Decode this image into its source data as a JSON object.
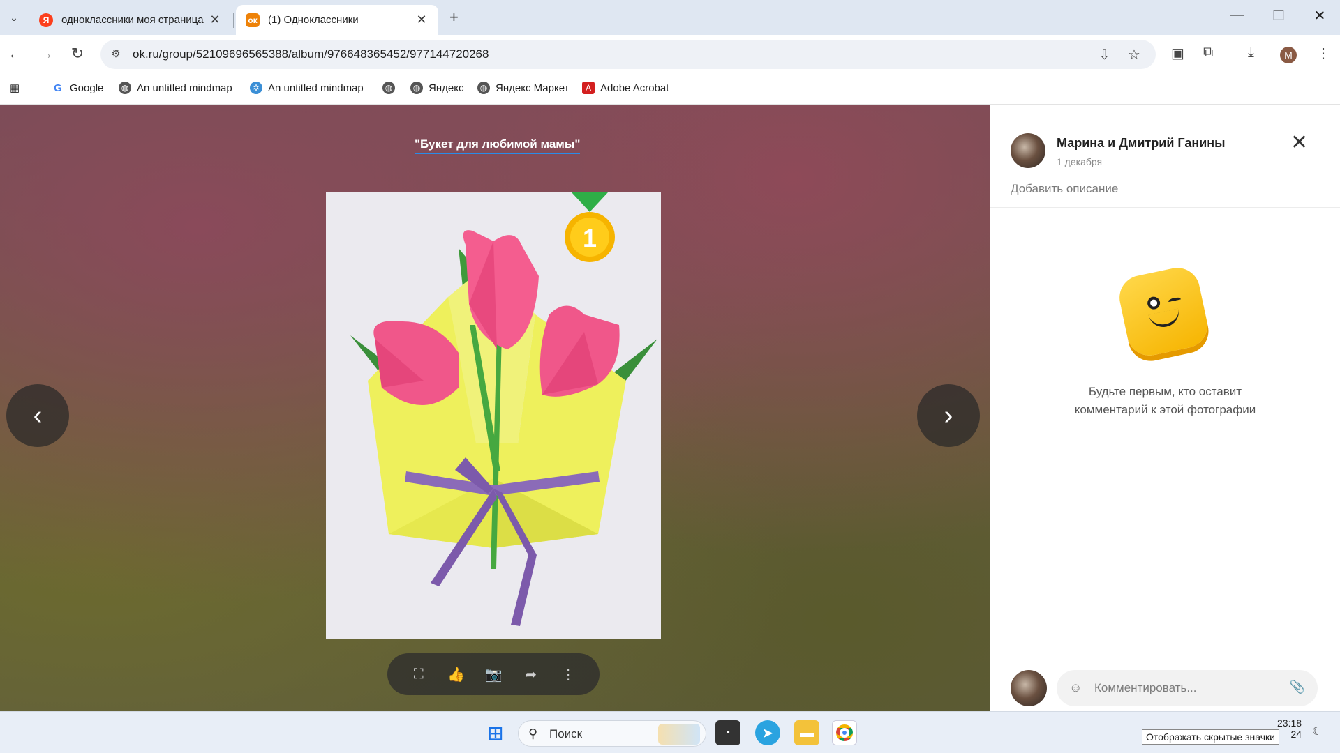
{
  "tabs": [
    {
      "label": "одноклассники моя страница",
      "favicon_letter": "Я",
      "favicon_color": "#fc3f1d",
      "active": false
    },
    {
      "label": "(1) Одноклассники",
      "favicon_letter": "ok",
      "favicon_color": "#ee8208",
      "active": true
    }
  ],
  "address_bar": {
    "url": "ok.ru/group/52109696565388/album/976648365452/977144720268"
  },
  "bookmarks": [
    {
      "label": "Google",
      "icon": "google-icon"
    },
    {
      "label": "An untitled mindmap",
      "icon": "globe-icon"
    },
    {
      "label": "An untitled mindmap",
      "icon": "mindmap-icon"
    },
    {
      "label": "",
      "icon": "globe-icon"
    },
    {
      "label": "Яндекс",
      "icon": "globe-icon"
    },
    {
      "label": "Яндекс Маркет",
      "icon": "globe-icon"
    },
    {
      "label": "Adobe Acrobat",
      "icon": "acrobat-icon"
    }
  ],
  "viewer": {
    "album_title": "\"Букет для любимой мамы\"",
    "badge_number": "1",
    "toolbar_icons": [
      "fullscreen-icon",
      "like-icon",
      "camera-icon",
      "share-icon",
      "more-icon"
    ]
  },
  "sidebar": {
    "author": "Марина и Дмитрий Ганины",
    "date": "1 декабря",
    "add_description": "Добавить описание",
    "empty_comments_text": "Будьте первым, кто оставит комментарий к этой фотографии",
    "comment_placeholder": "Комментировать..."
  },
  "taskbar": {
    "search_label": "Поиск",
    "time": "23:18",
    "date_fragment": "24",
    "tooltip": "Отображать скрытые значки"
  },
  "profile_initial": "M",
  "colors": {
    "accent_underline": "#2a8be8",
    "ok_orange": "#ee8208"
  }
}
